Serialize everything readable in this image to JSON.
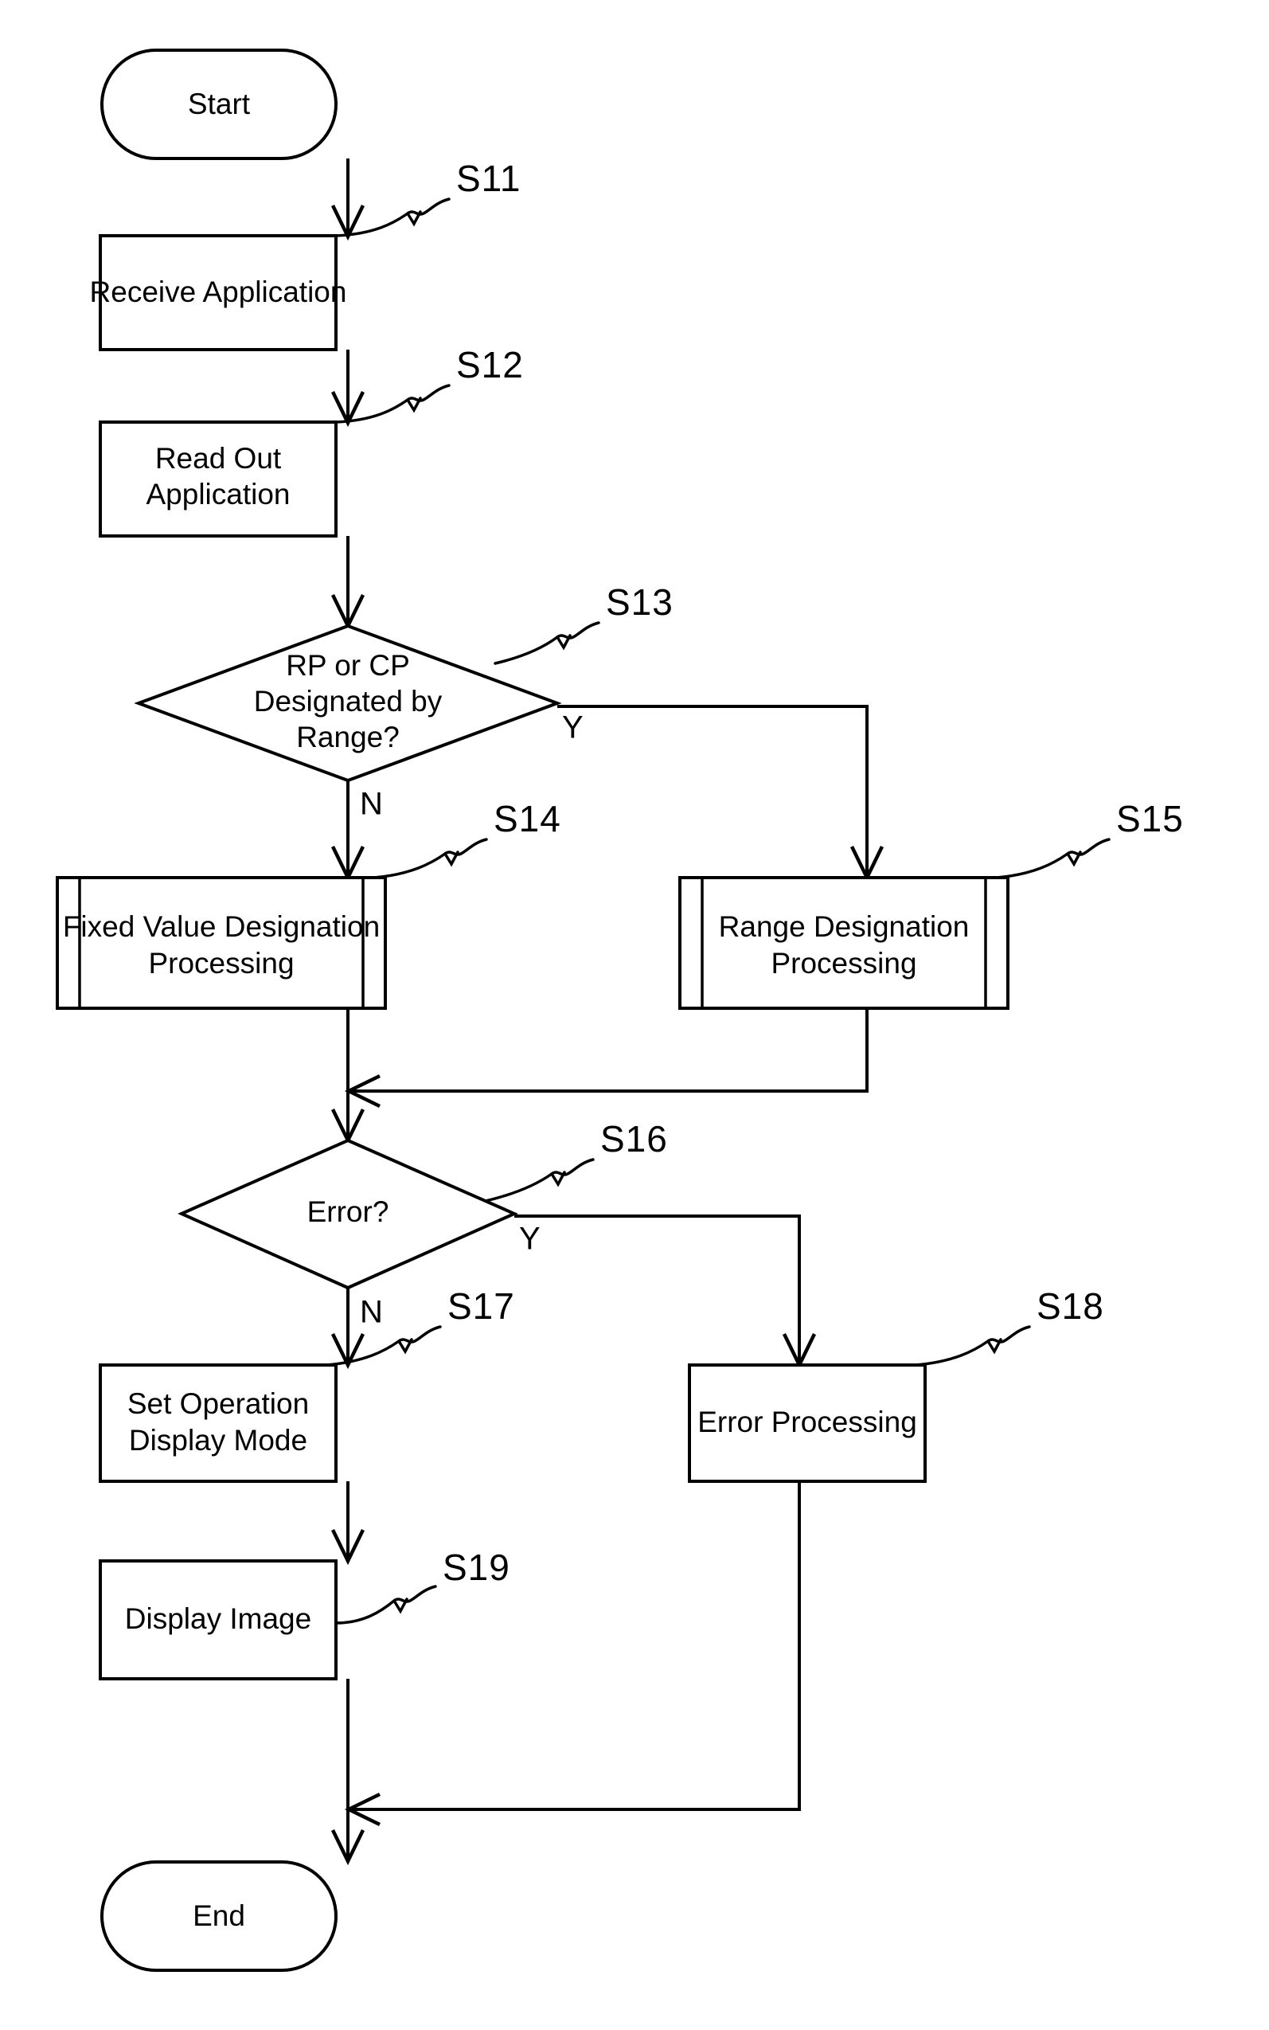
{
  "diagram": {
    "type": "flowchart",
    "title": "Application Designation Processing Flowchart",
    "nodes": [
      {
        "id": "start",
        "shape": "terminator",
        "lines": [
          "Start"
        ]
      },
      {
        "id": "s11",
        "shape": "process",
        "lines": [
          "Receive Application"
        ]
      },
      {
        "id": "s12",
        "shape": "process",
        "lines": [
          "Read Out",
          "Application"
        ]
      },
      {
        "id": "s13",
        "shape": "decision",
        "lines": [
          "RP or CP",
          "Designated by",
          "Range?"
        ]
      },
      {
        "id": "s14",
        "shape": "subroutine",
        "lines": [
          "Fixed Value Designation",
          "Processing"
        ]
      },
      {
        "id": "s15",
        "shape": "subroutine",
        "lines": [
          "Range Designation",
          "Processing"
        ]
      },
      {
        "id": "s16",
        "shape": "decision",
        "lines": [
          "Error?"
        ]
      },
      {
        "id": "s17",
        "shape": "process",
        "lines": [
          "Set Operation",
          "Display Mode"
        ]
      },
      {
        "id": "s18",
        "shape": "process",
        "lines": [
          "Error Processing"
        ]
      },
      {
        "id": "s19",
        "shape": "process",
        "lines": [
          "Display Image"
        ]
      },
      {
        "id": "end",
        "shape": "terminator",
        "lines": [
          "End"
        ]
      }
    ],
    "step_labels": [
      {
        "id": "lbl-s11",
        "text": "S11"
      },
      {
        "id": "lbl-s12",
        "text": "S12"
      },
      {
        "id": "lbl-s13",
        "text": "S13"
      },
      {
        "id": "lbl-s14",
        "text": "S14"
      },
      {
        "id": "lbl-s15",
        "text": "S15"
      },
      {
        "id": "lbl-s16",
        "text": "S16"
      },
      {
        "id": "lbl-s17",
        "text": "S17"
      },
      {
        "id": "lbl-s18",
        "text": "S18"
      },
      {
        "id": "lbl-s19",
        "text": "S19"
      }
    ],
    "branch_labels": [
      {
        "id": "s13-yes",
        "text": "Y"
      },
      {
        "id": "s13-no",
        "text": "N"
      },
      {
        "id": "s16-yes",
        "text": "Y"
      },
      {
        "id": "s16-no",
        "text": "N"
      }
    ],
    "colors": {
      "stroke": "#000000",
      "fill": "#ffffff",
      "background": "#ffffff"
    }
  },
  "text": {
    "start": "Start",
    "s11_l1": "Receive Application",
    "s12_l1": "Read Out",
    "s12_l2": "Application",
    "s13_l1": "RP or CP",
    "s13_l2": "Designated by",
    "s13_l3": "Range?",
    "s14_l1": "Fixed Value Designation",
    "s14_l2": "Processing",
    "s15_l1": "Range Designation",
    "s15_l2": "Processing",
    "s16_l1": "Error?",
    "s17_l1": "Set Operation",
    "s17_l2": "Display Mode",
    "s18_l1": "Error Processing",
    "s19_l1": "Display Image",
    "end": "End",
    "lbl_s11": "S11",
    "lbl_s12": "S12",
    "lbl_s13": "S13",
    "lbl_s14": "S14",
    "lbl_s15": "S15",
    "lbl_s16": "S16",
    "lbl_s17": "S17",
    "lbl_s18": "S18",
    "lbl_s19": "S19",
    "y1": "Y",
    "n1": "N",
    "y2": "Y",
    "n2": "N"
  }
}
